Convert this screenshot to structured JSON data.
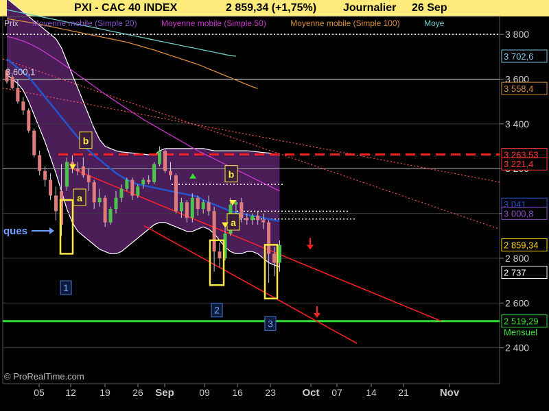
{
  "header": {
    "instrument": "PXI - CAC 40 INDEX",
    "quote": "2 859,34 (+1,75%)",
    "period": "Journalier",
    "date": "26 Sep"
  },
  "legend": {
    "items": [
      {
        "label": "Prix",
        "color": "#c8c8c8"
      },
      {
        "label": "Moyenne mobile (Simple 20)",
        "color": "#8a4dcc"
      },
      {
        "label": "Moyenne mobile (Simple 50)",
        "color": "#cc33cc"
      },
      {
        "label": "Moyenne mobile (Simple 100)",
        "color": "#d98c33"
      },
      {
        "label": "Moye",
        "color": "#66cccc"
      }
    ]
  },
  "watermark": "© ProRealTime.com",
  "colors": {
    "background": "#000000",
    "header_bg": "#ffeb7a",
    "bollinger_fill": "#4b1e5a",
    "candle_up": "#4cc44c",
    "candle_down": "#e07b7b",
    "resistance": "#ff2020",
    "support": "#33dd33",
    "label_box": "#ffeb3b"
  },
  "chart_data": {
    "type": "candlestick",
    "x_tick_labels": [
      "05",
      "12",
      "19",
      "26",
      "Sep",
      "09",
      "16",
      "23",
      "Oct",
      "07",
      "14",
      "21",
      "Nov"
    ],
    "y_tick_labels": [
      "3 800",
      "3 600",
      "3 400",
      "3 200",
      "3 000",
      "2 800",
      "2 600",
      "2 400"
    ],
    "y_ticks": [
      3800,
      3600,
      3400,
      3200,
      3000,
      2800,
      2600,
      2400
    ],
    "ylim": [
      2240,
      3880
    ],
    "price_tags": [
      {
        "text": "3 702,6",
        "value": 3702.6,
        "color": "#7ec8e3"
      },
      {
        "text": "3 558,4",
        "value": 3558.4,
        "color": "#d98c33"
      },
      {
        "text": "3 263,53",
        "value": 3263.53,
        "color": "#ff3333"
      },
      {
        "text": "3 221,4",
        "value": 3221.4,
        "color": "#ff3333"
      },
      {
        "text": "3 041",
        "value": 3041,
        "color": "#2255cc"
      },
      {
        "text": "3 000,8",
        "value": 3000.8,
        "color": "#8a4dcc"
      },
      {
        "text": "2 859,34",
        "value": 2859.34,
        "color": "#ffd700"
      },
      {
        "text": "2 737",
        "value": 2737,
        "color": "#ffffff"
      },
      {
        "text": "2 519,29",
        "value": 2519.29,
        "color": "#33dd33"
      }
    ],
    "support_tag_note": "Mensuel",
    "level_3600_label": "3 600,1",
    "levels": {
      "dotted_top": 3800,
      "resistance_dashed": 3263.53,
      "support_green": 2519.29,
      "short_dotted": [
        3130,
        3010,
        2975
      ]
    },
    "candles": [
      [
        3640,
        3640,
        3580,
        3590
      ],
      [
        3610,
        3625,
        3555,
        3560
      ],
      [
        3560,
        3600,
        3490,
        3500
      ],
      [
        3500,
        3520,
        3440,
        3460
      ],
      [
        3460,
        3470,
        3360,
        3370
      ],
      [
        3370,
        3380,
        3250,
        3260
      ],
      [
        3260,
        3280,
        3170,
        3190
      ],
      [
        3190,
        3210,
        3120,
        3150
      ],
      [
        3150,
        3180,
        3060,
        3080
      ],
      [
        3080,
        3120,
        2970,
        3010
      ],
      [
        3100,
        3220,
        2900,
        2950
      ],
      [
        3120,
        3250,
        3100,
        3230
      ],
      [
        3230,
        3260,
        3180,
        3200
      ],
      [
        3200,
        3230,
        3170,
        3190
      ],
      [
        3210,
        3250,
        3160,
        3170
      ],
      [
        3170,
        3200,
        3100,
        3140
      ],
      [
        3140,
        3150,
        3020,
        3050
      ],
      [
        3050,
        3110,
        3030,
        3070
      ],
      [
        3070,
        3080,
        2940,
        2960
      ],
      [
        2960,
        3030,
        2950,
        3020
      ],
      [
        3020,
        3100,
        3000,
        3070
      ],
      [
        3070,
        3130,
        3050,
        3110
      ],
      [
        3110,
        3160,
        3100,
        3150
      ],
      [
        3150,
        3160,
        3060,
        3080
      ],
      [
        3080,
        3130,
        3070,
        3120
      ],
      [
        3130,
        3160,
        3110,
        3150
      ],
      [
        3150,
        3170,
        3130,
        3140
      ],
      [
        3140,
        3230,
        3130,
        3220
      ],
      [
        3220,
        3300,
        3210,
        3280
      ],
      [
        3280,
        3290,
        3180,
        3190
      ],
      [
        3190,
        3230,
        3150,
        3170
      ],
      [
        3170,
        3180,
        3000,
        3010
      ],
      [
        3010,
        3070,
        2980,
        3050
      ],
      [
        3050,
        3060,
        2960,
        2980
      ],
      [
        2980,
        3090,
        2960,
        3070
      ],
      [
        3070,
        3080,
        2990,
        3020
      ],
      [
        3020,
        3060,
        3000,
        3050
      ],
      [
        3050,
        3080,
        2990,
        3010
      ],
      [
        3010,
        3030,
        2740,
        2830
      ],
      [
        2830,
        2870,
        2760,
        2800
      ],
      [
        2800,
        2950,
        2790,
        2910
      ],
      [
        2910,
        3070,
        2900,
        3040
      ],
      [
        3040,
        3060,
        3000,
        3050
      ],
      [
        3050,
        3070,
        2960,
        2980
      ],
      [
        2980,
        3000,
        2950,
        2970
      ],
      [
        2970,
        3000,
        2950,
        2990
      ],
      [
        2990,
        3010,
        2950,
        2970
      ],
      [
        2970,
        3000,
        2930,
        2960
      ],
      [
        2960,
        2970,
        2690,
        2820
      ],
      [
        2820,
        2850,
        2720,
        2780
      ],
      [
        2780,
        2880,
        2740,
        2859.34
      ]
    ],
    "series": [
      {
        "name": "Moyenne mobile (Simple 20)",
        "color": "#2255cc",
        "values": [
          3690,
          3670,
          3650,
          3630,
          3610,
          3580,
          3550,
          3520,
          3490,
          3460,
          3430,
          3400,
          3370,
          3340,
          3310,
          3280,
          3260,
          3240,
          3220,
          3200,
          3180,
          3165,
          3150,
          3140,
          3130,
          3125,
          3120,
          3115,
          3110,
          3105,
          3100,
          3095,
          3090,
          3085,
          3080,
          3075,
          3060,
          3050,
          3040,
          3030,
          3020,
          3010,
          3005,
          3000,
          2995,
          2990,
          2985,
          2980,
          2975,
          2970,
          2965
        ]
      },
      {
        "name": "Moyenne mobile (Simple 50)",
        "color": "#cc33cc",
        "values": [
          3790,
          3785,
          3778,
          3770,
          3760,
          3748,
          3735,
          3720,
          3704,
          3688,
          3672,
          3655,
          3638,
          3620,
          3603,
          3585,
          3568,
          3550,
          3533,
          3516,
          3500,
          3484,
          3468,
          3452,
          3436,
          3420,
          3406,
          3392,
          3378,
          3364,
          3350,
          3336,
          3322,
          3308,
          3294,
          3280,
          3268,
          3256,
          3244,
          3232,
          3220,
          3208,
          3196,
          3184,
          3172,
          3160,
          3148,
          3136,
          3124,
          3112,
          3100
        ]
      },
      {
        "name": "Moyenne mobile (Simple 100)",
        "color": "#d98c33",
        "values": [
          3870,
          3866,
          3862,
          3858,
          3854,
          3850,
          3845,
          3840,
          3835,
          3830,
          3825,
          3820,
          3815,
          3810,
          3805,
          3800,
          3795,
          3790,
          3785,
          3780,
          3775,
          3770,
          3765,
          3758,
          3751,
          3744,
          3737,
          3730,
          3722,
          3714,
          3706,
          3698,
          3690,
          3682,
          3674,
          3666,
          3656,
          3646,
          3636,
          3626,
          3616,
          3606,
          3596,
          3586,
          3576,
          3566,
          3558
        ]
      },
      {
        "name": "Moye",
        "color": "#66cccc",
        "values": [
          3910,
          3905,
          3900,
          3895,
          3890,
          3885,
          3880,
          3875,
          3870,
          3865,
          3860,
          3855,
          3850,
          3845,
          3840,
          3835,
          3830,
          3825,
          3820,
          3815,
          3810,
          3805,
          3800,
          3795,
          3790,
          3785,
          3780,
          3775,
          3770,
          3765,
          3760,
          3755,
          3750,
          3745,
          3740,
          3735,
          3730,
          3725,
          3720,
          3715,
          3710,
          3705,
          3702.6
        ]
      }
    ],
    "bollinger_upper": [
      3960,
      3940,
      3920,
      3900,
      3880,
      3860,
      3840,
      3820,
      3800,
      3780,
      3740,
      3680,
      3620,
      3560,
      3500,
      3440,
      3380,
      3330,
      3300,
      3290,
      3280,
      3275,
      3272,
      3270,
      3268,
      3265,
      3262,
      3260,
      3280,
      3290,
      3290,
      3290,
      3290,
      3290,
      3290,
      3290,
      3290,
      3285,
      3280,
      3280,
      3280,
      3280,
      3280,
      3280,
      3280,
      3278,
      3275,
      3272,
      3270,
      3265,
      3260
    ],
    "bollinger_lower": [
      3620,
      3600,
      3580,
      3550,
      3500,
      3440,
      3380,
      3320,
      3250,
      3180,
      3100,
      3020,
      2960,
      2920,
      2900,
      2880,
      2860,
      2840,
      2830,
      2820,
      2820,
      2830,
      2850,
      2870,
      2890,
      2910,
      2930,
      2950,
      2960,
      2960,
      2950,
      2940,
      2930,
      2920,
      2920,
      2930,
      2940,
      2930,
      2910,
      2880,
      2850,
      2830,
      2820,
      2820,
      2830,
      2830,
      2820,
      2800,
      2780,
      2770,
      2760
    ],
    "annotations": {
      "box_labels": [
        "a",
        "b",
        "a",
        "b",
        "a"
      ],
      "count_labels": [
        "1",
        "2",
        "3"
      ],
      "left_label": "ques"
    }
  }
}
